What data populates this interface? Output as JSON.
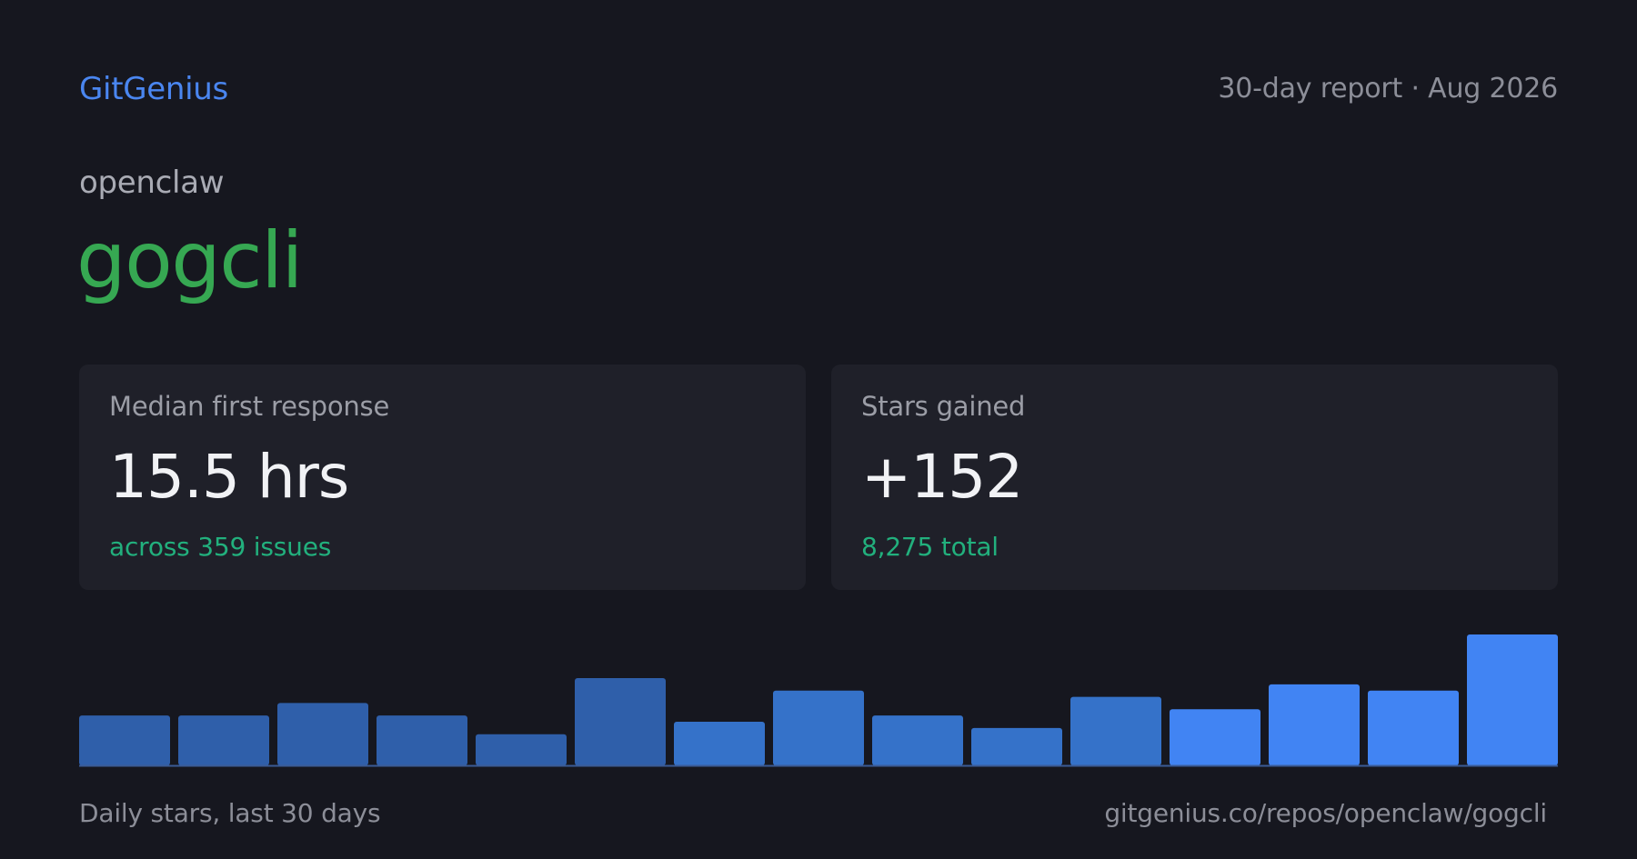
{
  "header": {
    "brand": "GitGenius",
    "report_label": "30-day report · Aug 2026"
  },
  "repo": {
    "owner": "openclaw",
    "name": "gogcli"
  },
  "stats": {
    "response": {
      "label": "Median first response",
      "value": "15.5 hrs",
      "sub": "across 359 issues"
    },
    "stars": {
      "label": "Stars gained",
      "value": "+152",
      "sub": "8,275 total"
    }
  },
  "footer": {
    "caption": "Daily stars, last 30 days",
    "url": "gitgenius.co/repos/openclaw/gogcli"
  },
  "colors": {
    "brand": "#4a86f0",
    "repo": "#36a852",
    "accent": "#22b07d"
  },
  "chart_data": {
    "type": "bar",
    "values": [
      8,
      8,
      10,
      8,
      5,
      14,
      7,
      12,
      8,
      6,
      11,
      9,
      13,
      12,
      21
    ],
    "bar_colors": [
      "#2f5faa",
      "#2f5faa",
      "#2f5faa",
      "#2f5faa",
      "#2f5faa",
      "#2f5faa",
      "#3572c9",
      "#3572c9",
      "#3572c9",
      "#3572c9",
      "#3572c9",
      "#4184f3",
      "#4184f3",
      "#4184f3",
      "#4184f3"
    ],
    "grid": false
  }
}
